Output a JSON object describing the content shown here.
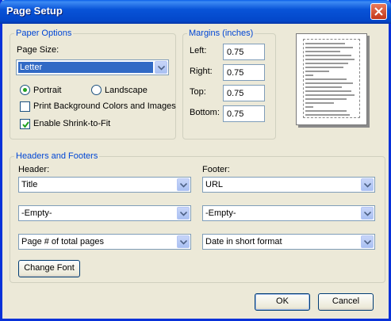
{
  "window": {
    "title": "Page Setup"
  },
  "paper_options": {
    "legend": "Paper Options",
    "page_size_label": "Page Size:",
    "page_size_value": "Letter",
    "portrait_label": "Portrait",
    "landscape_label": "Landscape",
    "print_bg_label": "Print Background Colors and Images",
    "shrink_label": "Enable Shrink-to-Fit",
    "orientation_selected": "Portrait",
    "print_bg_checked": false,
    "shrink_checked": true
  },
  "margins": {
    "legend": "Margins (inches)",
    "left_label": "Left:",
    "left_value": "0.75",
    "right_label": "Right:",
    "right_value": "0.75",
    "top_label": "Top:",
    "top_value": "0.75",
    "bottom_label": "Bottom:",
    "bottom_value": "0.75"
  },
  "headers_footers": {
    "legend": "Headers and Footers",
    "header_label": "Header:",
    "footer_label": "Footer:",
    "header_1": "Title",
    "header_2": "-Empty-",
    "header_3": "Page # of total pages",
    "footer_1": "URL",
    "footer_2": "-Empty-",
    "footer_3": "Date in short format",
    "change_font_label": "Change Font"
  },
  "buttons": {
    "ok": "OK",
    "cancel": "Cancel"
  },
  "colors": {
    "titlebar": "#0853d8",
    "group_legend": "#0046d5",
    "selection": "#316ac5",
    "dialog_bg": "#ece9d8"
  }
}
